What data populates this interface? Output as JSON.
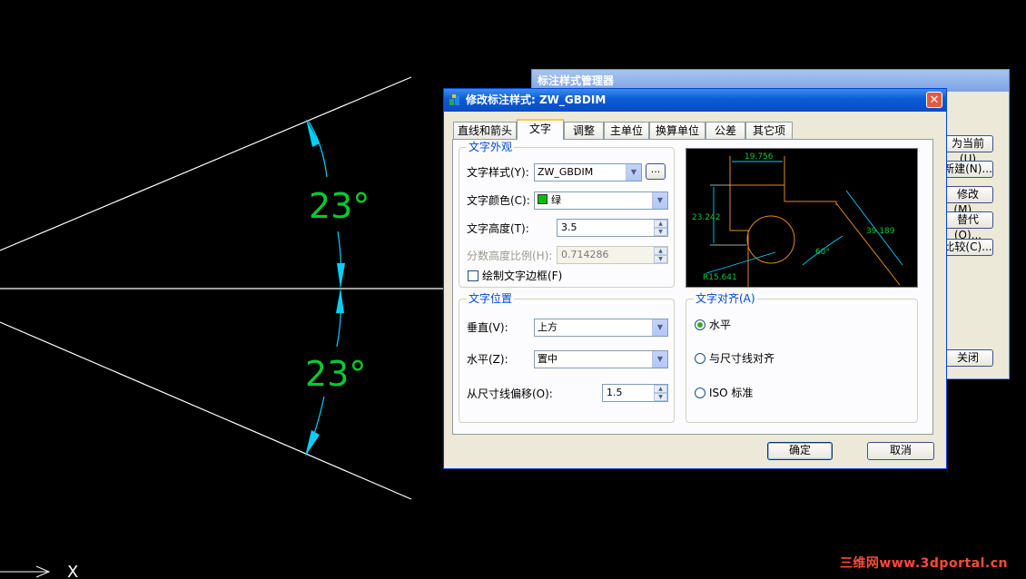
{
  "cad": {
    "angle_top": "23°",
    "angle_bottom": "23°",
    "axis_label": "X",
    "dim_color": "#00cc33",
    "arrow_color": "#00d0ff"
  },
  "back_dialog": {
    "title": "标注样式管理器",
    "buttons": [
      "为当前(U)",
      "新建(N)...",
      "修改(M)...",
      "替代(O)...",
      "比较(C)..."
    ],
    "close_label": "关闭"
  },
  "dialog": {
    "title": "修改标注样式: ZW_GBDIM",
    "tabs": [
      "直线和箭头",
      "文字",
      "调整",
      "主单位",
      "换算单位",
      "公差",
      "其它项"
    ],
    "active_tab": "文字",
    "text_appearance": {
      "group_title": "文字外观",
      "style_label": "文字样式(Y):",
      "style_value": "ZW_GBDIM",
      "browse_label": "...",
      "color_label": "文字颜色(C):",
      "color_value": "绿",
      "color_swatch": "#00c000",
      "height_label": "文字高度(T):",
      "height_value": "3.5",
      "fraction_label": "分数高度比例(H):",
      "fraction_value": "0.714286",
      "frame_label": "绘制文字边框(F)"
    },
    "text_placement": {
      "group_title": "文字位置",
      "vertical_label": "垂直(V):",
      "vertical_value": "上方",
      "horizontal_label": "水平(Z):",
      "horizontal_value": "置中",
      "offset_label": "从尺寸线偏移(O):",
      "offset_value": "1.5"
    },
    "text_alignment": {
      "group_title": "文字对齐(A)",
      "options": [
        "水平",
        "与尺寸线对齐",
        "ISO 标准"
      ],
      "selected": "水平"
    },
    "preview": {
      "dim_top": "19.756",
      "dim_left": "23.242",
      "dim_right": "39.189",
      "dim_angle": "60°",
      "dim_radius": "R15.641"
    },
    "ok_label": "确定",
    "cancel_label": "取消"
  },
  "watermark": "三维网www.3dportal.cn"
}
